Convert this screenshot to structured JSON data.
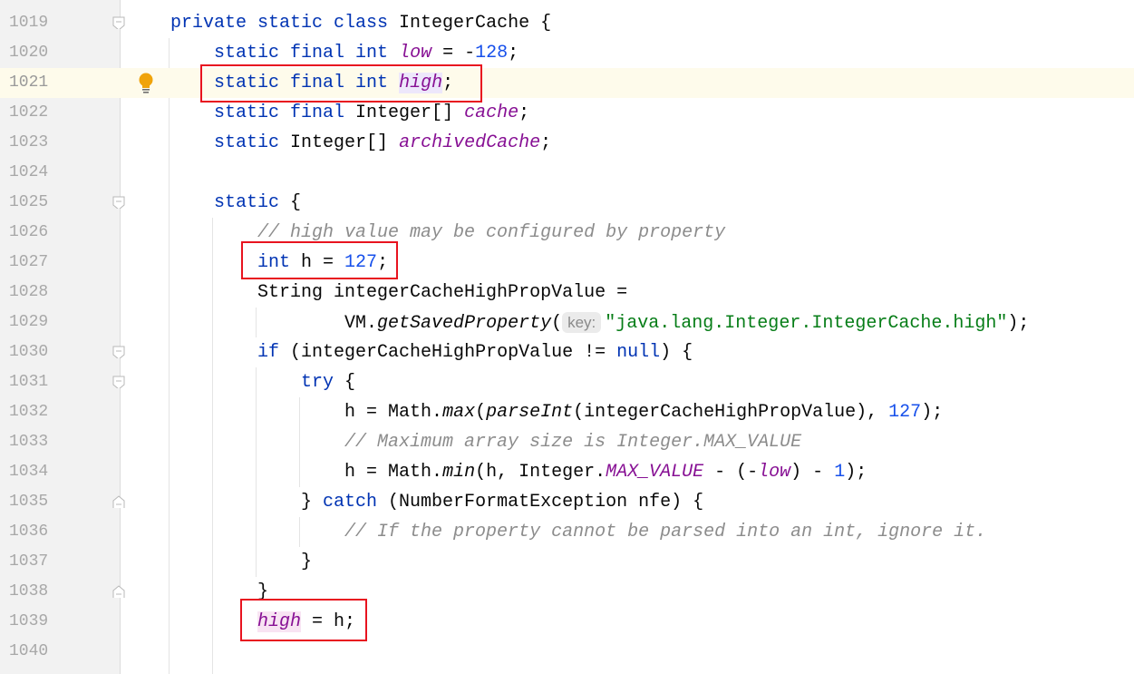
{
  "colors": {
    "keyword": "#0033b3",
    "number": "#1750eb",
    "field": "#871094",
    "comment": "#8c8c8c",
    "string": "#067d17",
    "highlight_box": "#e8131f",
    "current_line": "#fefbeb"
  },
  "current_line": 1021,
  "lines": [
    {
      "n": "1019",
      "t": [
        [
          "kw",
          "private static class "
        ],
        [
          "",
          "IntegerCache {"
        ]
      ]
    },
    {
      "n": "1020",
      "t": [
        [
          "",
          "    "
        ],
        [
          "kw",
          "static final int "
        ],
        [
          "fld",
          "low"
        ],
        [
          "",
          " = -"
        ],
        [
          "num",
          "128"
        ],
        [
          "",
          ";"
        ]
      ]
    },
    {
      "n": "1021",
      "t": [
        [
          "",
          "    "
        ],
        [
          "kw",
          "static final int "
        ],
        [
          "fld hl1",
          "high"
        ],
        [
          "",
          ";"
        ]
      ]
    },
    {
      "n": "1022",
      "t": [
        [
          "",
          "    "
        ],
        [
          "kw",
          "static final "
        ],
        [
          "",
          "Integer[] "
        ],
        [
          "fld",
          "cache"
        ],
        [
          "",
          ";"
        ]
      ]
    },
    {
      "n": "1023",
      "t": [
        [
          "",
          "    "
        ],
        [
          "kw",
          "static "
        ],
        [
          "",
          "Integer[] "
        ],
        [
          "fld",
          "archivedCache"
        ],
        [
          "",
          ";"
        ]
      ]
    },
    {
      "n": "1024",
      "t": []
    },
    {
      "n": "1025",
      "t": [
        [
          "",
          "    "
        ],
        [
          "kw",
          "static "
        ],
        [
          "",
          "{"
        ]
      ]
    },
    {
      "n": "1026",
      "t": [
        [
          "",
          "        "
        ],
        [
          "cmt",
          "// high value may be configured by property"
        ]
      ]
    },
    {
      "n": "1027",
      "t": [
        [
          "",
          "        "
        ],
        [
          "kw",
          "int "
        ],
        [
          "",
          "h = "
        ],
        [
          "num",
          "127"
        ],
        [
          "",
          ";"
        ]
      ]
    },
    {
      "n": "1028",
      "t": [
        [
          "",
          "        String integerCacheHighPropValue ="
        ]
      ]
    },
    {
      "n": "1029",
      "t": [
        [
          "",
          "                VM."
        ],
        [
          "mth",
          "getSavedProperty"
        ],
        [
          "",
          "("
        ],
        [
          "hint",
          "key:"
        ],
        [
          "str",
          "\"java.lang.Integer.IntegerCache.high\""
        ],
        [
          "",
          ");"
        ]
      ]
    },
    {
      "n": "1030",
      "t": [
        [
          "",
          "        "
        ],
        [
          "kw",
          "if "
        ],
        [
          "",
          "(integerCacheHighPropValue != "
        ],
        [
          "kw",
          "null"
        ],
        [
          "",
          ") {"
        ]
      ]
    },
    {
      "n": "1031",
      "t": [
        [
          "",
          "            "
        ],
        [
          "kw",
          "try "
        ],
        [
          "",
          "{"
        ]
      ]
    },
    {
      "n": "1032",
      "t": [
        [
          "",
          "                h = Math."
        ],
        [
          "mth",
          "max"
        ],
        [
          "",
          "("
        ],
        [
          "mth",
          "parseInt"
        ],
        [
          "",
          "(integerCacheHighPropValue), "
        ],
        [
          "num",
          "127"
        ],
        [
          "",
          ");"
        ]
      ]
    },
    {
      "n": "1033",
      "t": [
        [
          "",
          "                "
        ],
        [
          "cmt",
          "// Maximum array size is Integer.MAX_VALUE"
        ]
      ]
    },
    {
      "n": "1034",
      "t": [
        [
          "",
          "                h = Math."
        ],
        [
          "mth",
          "min"
        ],
        [
          "",
          "(h, Integer."
        ],
        [
          "sfld",
          "MAX_VALUE"
        ],
        [
          "",
          " - (-"
        ],
        [
          "fld",
          "low"
        ],
        [
          "",
          ") - "
        ],
        [
          "num",
          "1"
        ],
        [
          "",
          ");"
        ]
      ]
    },
    {
      "n": "1035",
      "t": [
        [
          "",
          "            } "
        ],
        [
          "kw",
          "catch "
        ],
        [
          "",
          "(NumberFormatException nfe) {"
        ]
      ]
    },
    {
      "n": "1036",
      "t": [
        [
          "",
          "                "
        ],
        [
          "cmt",
          "// If the property cannot be parsed into an int, ignore it."
        ]
      ]
    },
    {
      "n": "1037",
      "t": [
        [
          "",
          "            }"
        ]
      ]
    },
    {
      "n": "1038",
      "t": [
        [
          "",
          "        }"
        ]
      ]
    },
    {
      "n": "1039",
      "t": [
        [
          "",
          "        "
        ],
        [
          "fld hl2",
          "high"
        ],
        [
          "",
          " = h;"
        ]
      ]
    },
    {
      "n": "1040",
      "t": []
    }
  ],
  "fold_markers": [
    "1019",
    "1025",
    "1030",
    "1031",
    "1035",
    "1038"
  ],
  "icons": {
    "intention": "lightbulb-icon",
    "fold": "fold-marker-icon"
  }
}
